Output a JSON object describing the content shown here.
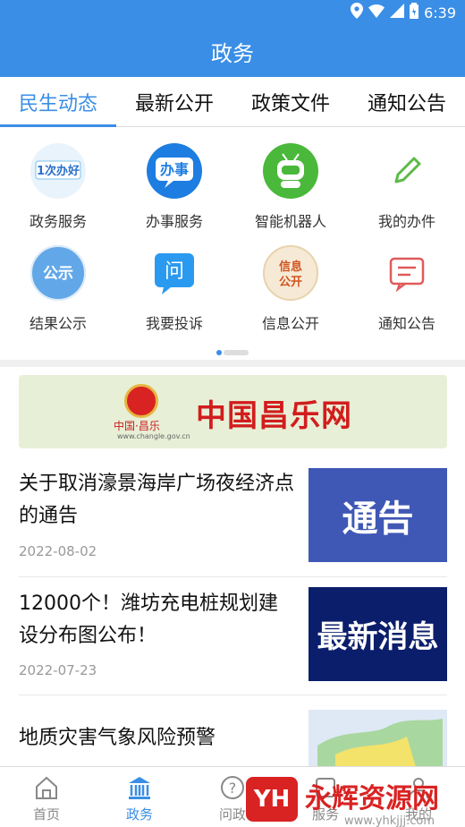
{
  "status_bar": {
    "time": "6:39"
  },
  "header": {
    "title": "政务"
  },
  "tabs": [
    {
      "label": "民生动态",
      "active": true
    },
    {
      "label": "最新公开",
      "active": false
    },
    {
      "label": "政策文件",
      "active": false
    },
    {
      "label": "通知公告",
      "active": false
    }
  ],
  "grid": {
    "row1": [
      {
        "label": "政务服务",
        "icon": "yicibanhao-logo-icon",
        "icon_text": "1次办好",
        "color": "#7ec0e8"
      },
      {
        "label": "办事服务",
        "icon": "banshi-icon",
        "icon_text": "办事",
        "color": "#1e7de0"
      },
      {
        "label": "智能机器人",
        "icon": "robot-icon",
        "color": "#4ab83a"
      },
      {
        "label": "我的办件",
        "icon": "pencil-icon",
        "color": "#5cba47"
      }
    ],
    "row2": [
      {
        "label": "结果公示",
        "icon": "gongshi-icon",
        "icon_text": "公示",
        "color": "#62a8e8"
      },
      {
        "label": "我要投诉",
        "icon": "question-chat-icon",
        "icon_text": "问",
        "color": "#2a9af0"
      },
      {
        "label": "信息公开",
        "icon": "xinxi-gongkai-icon",
        "icon_text_top": "信息",
        "icon_text_bottom": "公开",
        "color": "#f3e3c9"
      },
      {
        "label": "通知公告",
        "icon": "notice-icon",
        "color": "#e05a5a"
      }
    ]
  },
  "banner": {
    "title": "中国昌乐网",
    "small": "中国·昌乐",
    "url": "www.changle.gov.cn"
  },
  "news": [
    {
      "title": "关于取消濠景海岸广场夜经济点的通告",
      "date": "2022-08-02",
      "thumb_text": "通告",
      "thumb_color": "#3f57b5"
    },
    {
      "title": "12000个！潍坊充电桩规划建设分布图公布！",
      "date": "2022-07-23",
      "thumb_text": "最新消息",
      "thumb_color": "#0b1e6b"
    },
    {
      "title": "地质灾害气象风险预警",
      "date": "",
      "thumb_text": "",
      "thumb_color": "#dfe9f5"
    }
  ],
  "bottom_nav": [
    {
      "label": "首页",
      "icon": "home-icon",
      "active": false
    },
    {
      "label": "政务",
      "icon": "government-building-icon",
      "active": true
    },
    {
      "label": "问政",
      "icon": "question-icon",
      "active": false
    },
    {
      "label": "服务",
      "icon": "service-icon",
      "active": false
    },
    {
      "label": "我的",
      "icon": "user-icon",
      "active": false
    }
  ],
  "watermark": {
    "logo": "YH",
    "text": "永辉资源网",
    "url": "www.yhkjjj.com"
  },
  "colors": {
    "accent": "#3a8ee6",
    "banner_red": "#d11d1d"
  }
}
